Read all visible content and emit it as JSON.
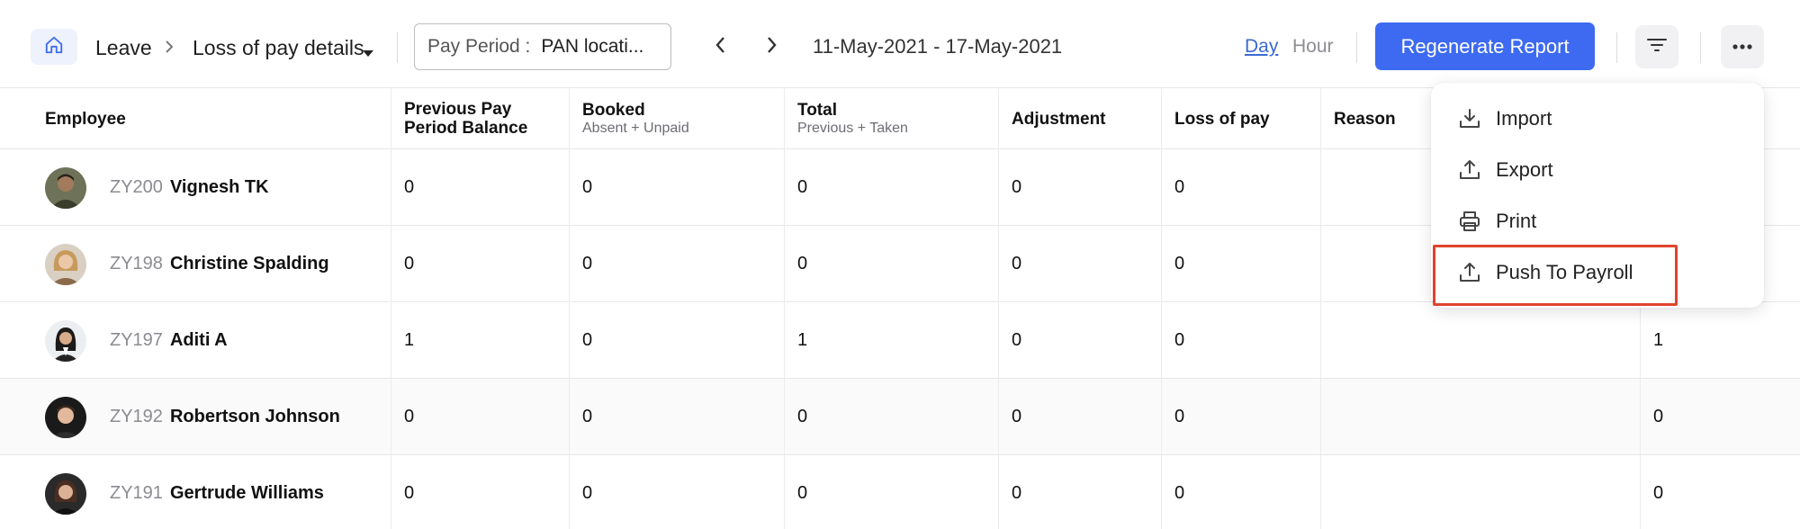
{
  "breadcrumb": {
    "items": [
      "Leave",
      "Loss of pay details"
    ]
  },
  "pay_period": {
    "label": "Pay Period :",
    "value": "PAN locati..."
  },
  "date_range": "11-May-2021 - 17-May-2021",
  "view_modes": {
    "day": "Day",
    "hour": "Hour",
    "active": "Day"
  },
  "toolbar": {
    "regenerate_label": "Regenerate Report"
  },
  "colors": {
    "primary": "#3d6af1",
    "highlight": "#e0432c",
    "link": "#3b6ad4"
  },
  "table": {
    "headers": [
      {
        "title": "Employee",
        "sub": ""
      },
      {
        "title": "Previous Pay Period Balance",
        "sub": ""
      },
      {
        "title": "Booked",
        "sub": "Absent + Unpaid"
      },
      {
        "title": "Total",
        "sub": "Previous + Taken"
      },
      {
        "title": "Adjustment",
        "sub": ""
      },
      {
        "title": "Loss of pay",
        "sub": ""
      },
      {
        "title": "Reason",
        "sub": ""
      }
    ],
    "rows": [
      {
        "id": "ZY200",
        "name": "Vignesh TK",
        "prev": "0",
        "booked": "0",
        "total": "0",
        "adjustment": "0",
        "lop": "0",
        "last": ""
      },
      {
        "id": "ZY198",
        "name": "Christine Spalding",
        "prev": "0",
        "booked": "0",
        "total": "0",
        "adjustment": "0",
        "lop": "0",
        "last": ""
      },
      {
        "id": "ZY197",
        "name": "Aditi A",
        "prev": "1",
        "booked": "0",
        "total": "1",
        "adjustment": "0",
        "lop": "0",
        "last": "1"
      },
      {
        "id": "ZY192",
        "name": "Robertson Johnson",
        "prev": "0",
        "booked": "0",
        "total": "0",
        "adjustment": "0",
        "lop": "0",
        "last": "0"
      },
      {
        "id": "ZY191",
        "name": "Gertrude Williams",
        "prev": "0",
        "booked": "0",
        "total": "0",
        "adjustment": "0",
        "lop": "0",
        "last": "0"
      }
    ]
  },
  "menu": {
    "items": [
      {
        "label": "Import",
        "icon": "import-icon"
      },
      {
        "label": "Export",
        "icon": "export-icon"
      },
      {
        "label": "Print",
        "icon": "print-icon"
      },
      {
        "label": "Push To Payroll",
        "icon": "push-icon"
      }
    ],
    "highlighted": "Push To Payroll"
  }
}
